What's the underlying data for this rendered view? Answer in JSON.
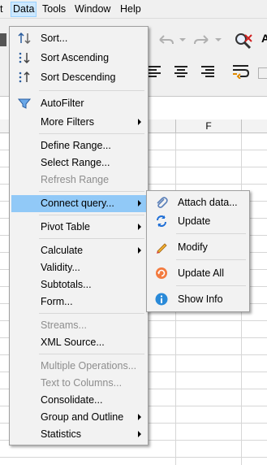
{
  "menubar": {
    "items": [
      "t",
      "Data",
      "Tools",
      "Window",
      "Help"
    ]
  },
  "toolbar": {
    "partial_text": "A"
  },
  "sheet": {
    "col_f": "F"
  },
  "data_menu": {
    "items": [
      {
        "label": "Sort...",
        "icon": "sort-icon",
        "disabled": false
      },
      {
        "label": "Sort Ascending",
        "icon": "sort-ascending-icon",
        "disabled": false
      },
      {
        "label": "Sort Descending",
        "icon": "sort-descending-icon",
        "disabled": false
      },
      {
        "label": "AutoFilter",
        "icon": "autofilter-icon",
        "disabled": false
      },
      {
        "label": "More Filters",
        "submenu": true,
        "disabled": false
      },
      {
        "label": "Define Range...",
        "disabled": false
      },
      {
        "label": "Select Range...",
        "disabled": false
      },
      {
        "label": "Refresh Range",
        "disabled": true
      },
      {
        "label": "Connect query...",
        "submenu": true,
        "highlighted": true,
        "disabled": false
      },
      {
        "label": "Pivot Table",
        "submenu": true,
        "disabled": false
      },
      {
        "label": "Calculate",
        "submenu": true,
        "disabled": false
      },
      {
        "label": "Validity...",
        "disabled": false
      },
      {
        "label": "Subtotals...",
        "disabled": false
      },
      {
        "label": "Form...",
        "disabled": false
      },
      {
        "label": "Streams...",
        "disabled": true
      },
      {
        "label": "XML Source...",
        "disabled": false
      },
      {
        "label": "Multiple Operations...",
        "disabled": true
      },
      {
        "label": "Text to Columns...",
        "disabled": true
      },
      {
        "label": "Consolidate...",
        "disabled": false
      },
      {
        "label": "Group and Outline",
        "submenu": true,
        "disabled": false
      },
      {
        "label": "Statistics",
        "submenu": true,
        "disabled": false
      }
    ]
  },
  "connect_submenu": {
    "items": [
      {
        "label": "Attach data...",
        "icon": "paperclip-icon"
      },
      {
        "label": "Update",
        "icon": "refresh-icon"
      },
      {
        "label": "Modify",
        "icon": "pencil-icon"
      },
      {
        "label": "Update All",
        "icon": "update-all-icon"
      },
      {
        "label": "Show Info",
        "icon": "info-icon"
      }
    ]
  },
  "colors": {
    "highlight": "#91c9f7",
    "menu_bg": "#f2f2f2",
    "disabled_text": "#8d8d8d"
  }
}
